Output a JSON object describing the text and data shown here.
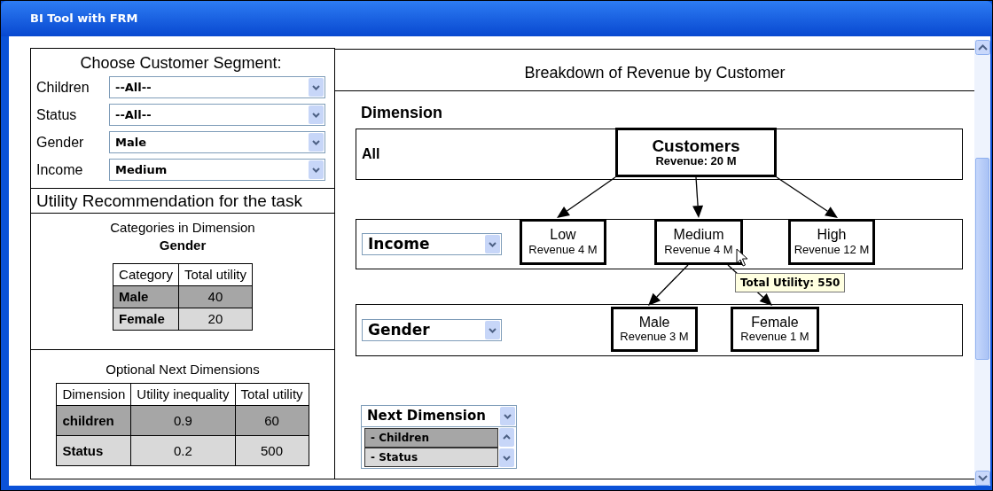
{
  "window": {
    "title": "BI Tool with FRM"
  },
  "segment": {
    "title": "Choose Customer Segment:",
    "filters": [
      {
        "label": "Children",
        "value": "--All--"
      },
      {
        "label": "Status",
        "value": "--All--"
      },
      {
        "label": "Gender",
        "value": "Male"
      },
      {
        "label": "Income",
        "value": "Medium"
      }
    ]
  },
  "recommendation": {
    "title": "Utility Recommendation for the task",
    "categories": {
      "title": "Categories in Dimension",
      "dimension": "Gender",
      "columns": [
        "Category",
        "Total utility"
      ],
      "rows": [
        {
          "cells": [
            "Male",
            "40"
          ],
          "selected": true
        },
        {
          "cells": [
            "Female",
            "20"
          ],
          "selected": false
        }
      ]
    },
    "next_dimensions": {
      "title": "Optional Next Dimensions",
      "columns": [
        "Dimension",
        "Utility inequality",
        "Total utility"
      ],
      "rows": [
        {
          "cells": [
            "children",
            "0.9",
            "60"
          ],
          "selected": true
        },
        {
          "cells": [
            "Status",
            "0.2",
            "500"
          ],
          "selected": false
        }
      ]
    }
  },
  "breakdown": {
    "title": "Breakdown of Revenue by Customer",
    "dimension_heading": "Dimension",
    "levels": [
      {
        "kind": "label",
        "label": "All"
      },
      {
        "kind": "select",
        "value": "Income"
      },
      {
        "kind": "select",
        "value": "Gender"
      }
    ],
    "tree": {
      "name": "Customers",
      "revenue": "Revenue: 20 M",
      "children": [
        {
          "name": "Low",
          "revenue": "Revenue 4 M"
        },
        {
          "name": "Medium",
          "revenue": "Revenue 4 M",
          "children": [
            {
              "name": "Male",
              "revenue": "Revenue 3 M"
            },
            {
              "name": "Female",
              "revenue": "Revenue 1 M"
            }
          ]
        },
        {
          "name": "High",
          "revenue": "Revenue 12 M"
        }
      ]
    },
    "tooltip": "Total Utility: 550",
    "next_dimension": {
      "value": "Next Dimension",
      "options": [
        {
          "label": "- Children",
          "selected": true
        },
        {
          "label": "- Status",
          "selected": false
        }
      ]
    }
  }
}
